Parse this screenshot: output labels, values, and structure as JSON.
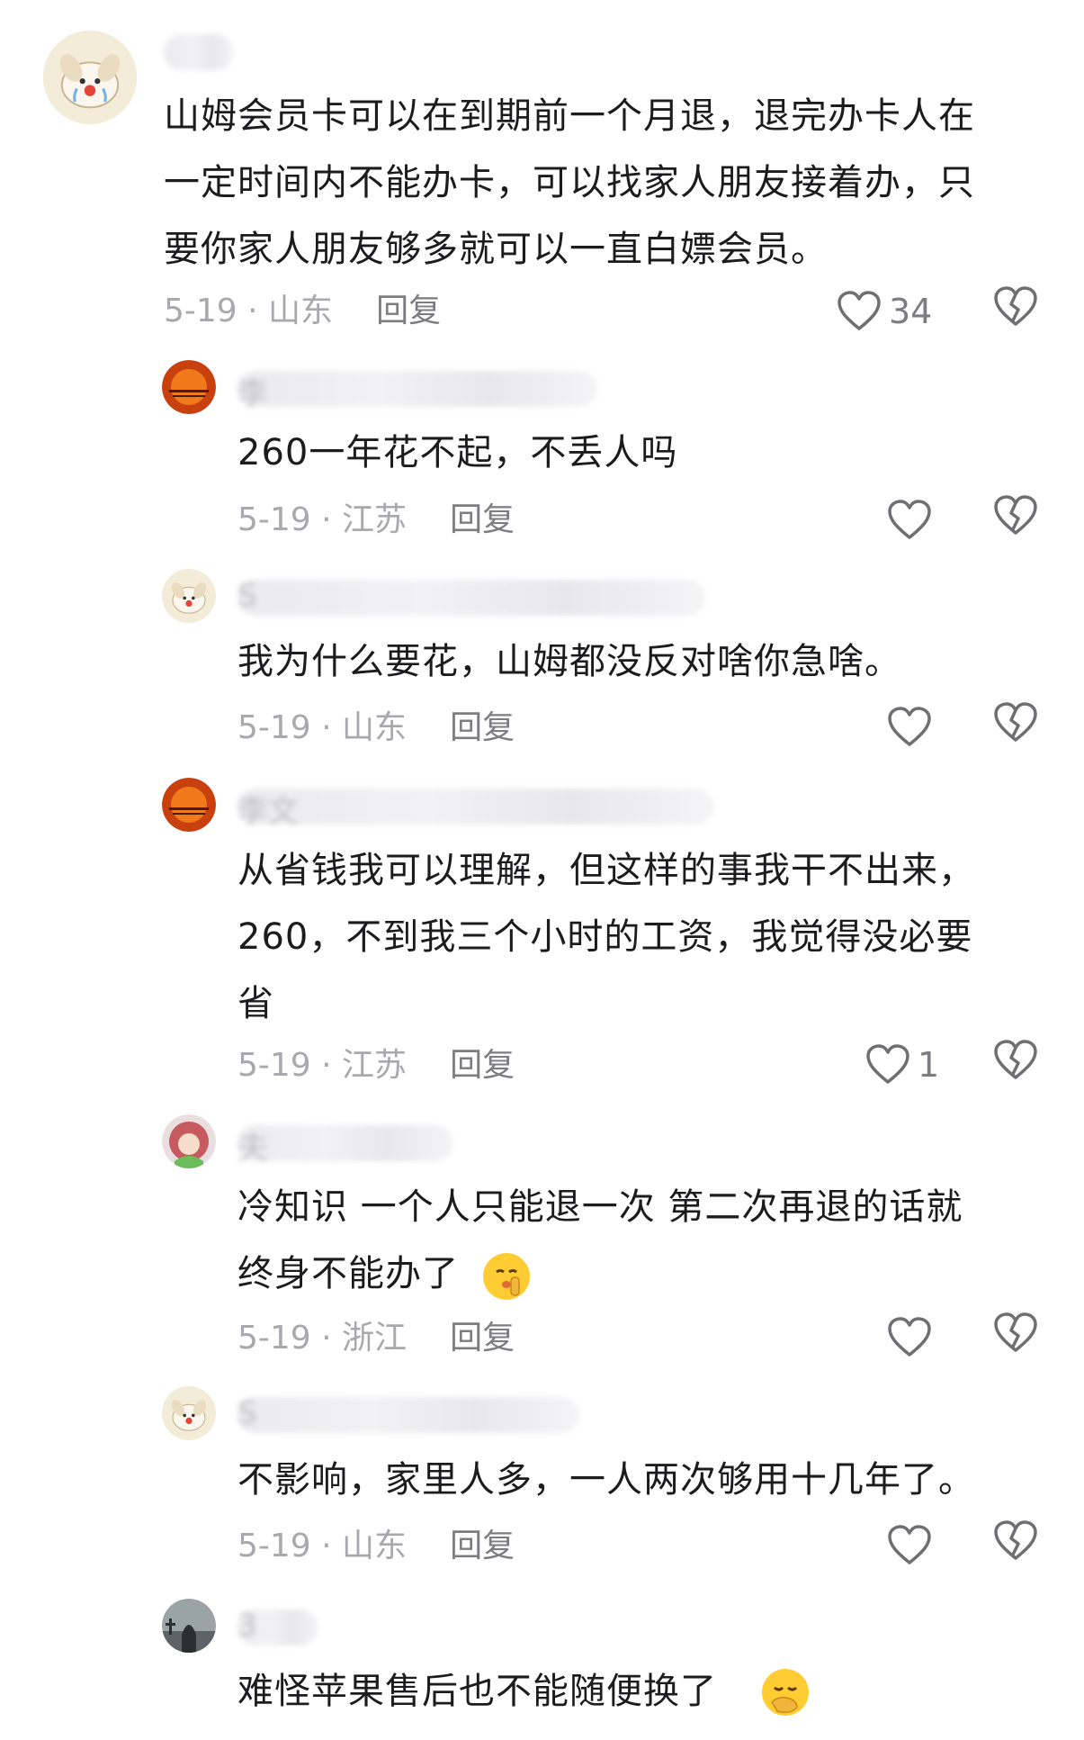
{
  "comments": [
    {
      "text": "山姆会员卡可以在到期前一个月退，退完办卡人在\n一定时间内不能办卡，可以找家人朋友接着办，只\n要你家人朋友够多就可以一直白嫖会员。",
      "date": "5-19",
      "region": "山东",
      "reply_label": "回复",
      "like_count": "34",
      "username_hint": ""
    },
    {
      "text": "260一年花不起，不丢人吗",
      "date": "5-19",
      "region": "江苏",
      "reply_label": "回复",
      "like_count": "",
      "username_hint": "李"
    },
    {
      "text": "我为什么要花，山姆都没反对啥你急啥。",
      "date": "5-19",
      "region": "山东",
      "reply_label": "回复",
      "like_count": "",
      "username_hint": "S"
    },
    {
      "text": "从省钱我可以理解，但这样的事我干不出来，\n260，不到我三个小时的工资，我觉得没必要\n省",
      "date": "5-19",
      "region": "江苏",
      "reply_label": "回复",
      "like_count": "1",
      "username_hint": "李文"
    },
    {
      "text": "冷知识 一个人只能退一次 第二次再退的话就\n终身不能办了",
      "date": "5-19",
      "region": "浙江",
      "reply_label": "回复",
      "like_count": "",
      "username_hint": "夫"
    },
    {
      "text": "不影响，家里人多，一人两次够用十几年了。",
      "date": "5-19",
      "region": "山东",
      "reply_label": "回复",
      "like_count": "",
      "username_hint": "S"
    },
    {
      "text": "难怪苹果售后也不能随便换了",
      "date": "",
      "region": "",
      "reply_label": "",
      "like_count": "",
      "username_hint": "3"
    }
  ],
  "icons": {
    "like": "heart-icon",
    "dislike": "broken-heart-icon",
    "emoji_shush": "shushing-face-emoji",
    "emoji_hand_over_mouth": "hand-over-mouth-emoji"
  },
  "colors": {
    "text": "#1c1c1e",
    "meta": "#a8a8ae",
    "reply": "#7c7c82",
    "icon": "#6e6e73"
  }
}
